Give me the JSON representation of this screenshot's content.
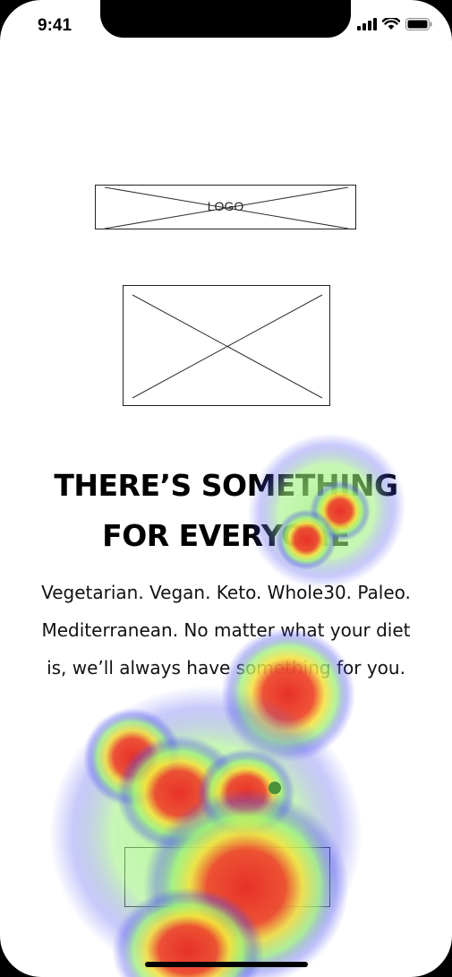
{
  "status_bar": {
    "time": "9:41",
    "icons": [
      "signal-icon",
      "wifi-icon",
      "battery-icon"
    ]
  },
  "logo": {
    "label": "LOGO"
  },
  "hero_image": {
    "icon": "image-placeholder-icon"
  },
  "headline": {
    "line1": "THERE’S SOMETHING",
    "line2": "FOR EVERYONE"
  },
  "body": {
    "line1": "Vegetarian. Vegan. Keto. Whole30. Paleo.",
    "line2": "Mediterranean. No matter what your diet",
    "line3": "is, we’ll always have something for you."
  },
  "cta": {
    "label": ""
  },
  "heatmap": {
    "colors": {
      "hot": "#e8302a",
      "warm": "#f5e13a",
      "mid": "#9cf07a",
      "cool": "#4a4cf0"
    }
  }
}
